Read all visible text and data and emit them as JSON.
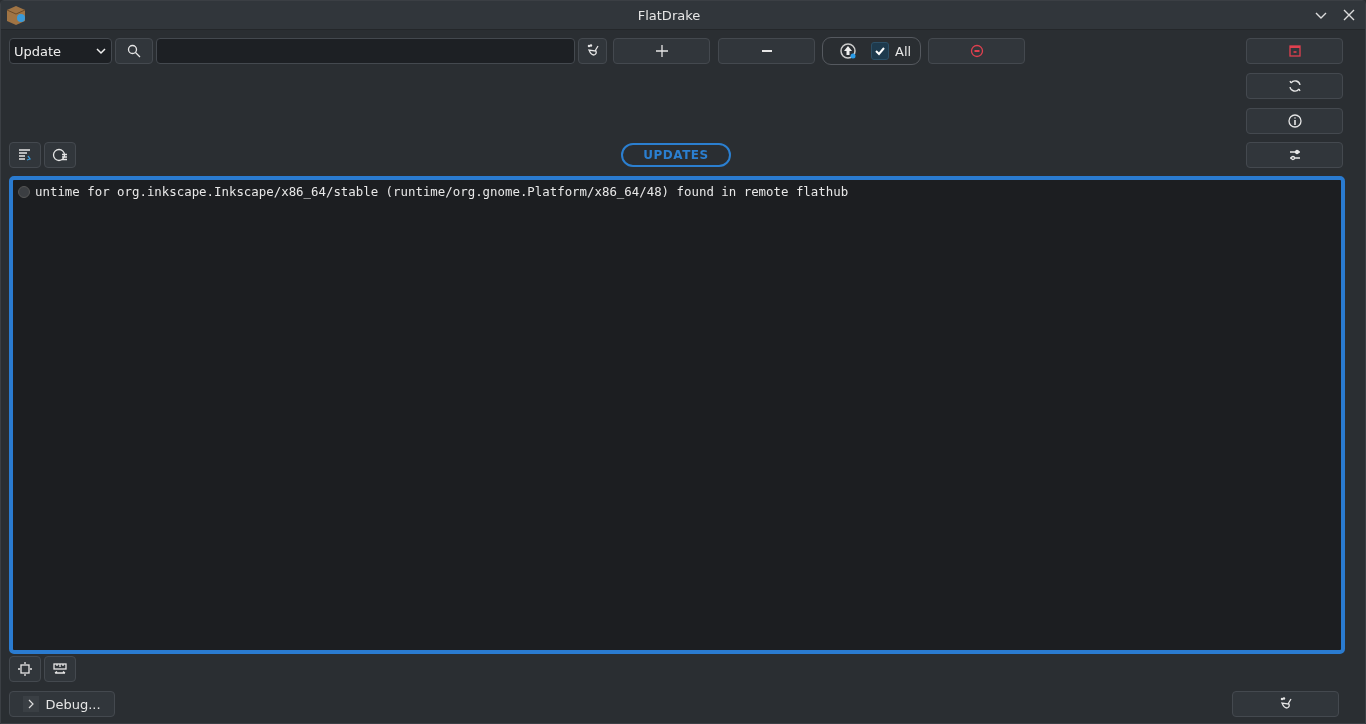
{
  "window": {
    "title": "FlatDrake"
  },
  "toolbar": {
    "mode": "Update",
    "all_checkbox": {
      "label": "All",
      "checked": true
    }
  },
  "section_label": "UPDATES",
  "log": {
    "lines": [
      "untime for org.inkscape.Inkscape/x86_64/stable (runtime/org.gnome.Platform/x86_64/48) found in remote flathub"
    ]
  },
  "footer": {
    "debug_button": "Debug..."
  }
}
